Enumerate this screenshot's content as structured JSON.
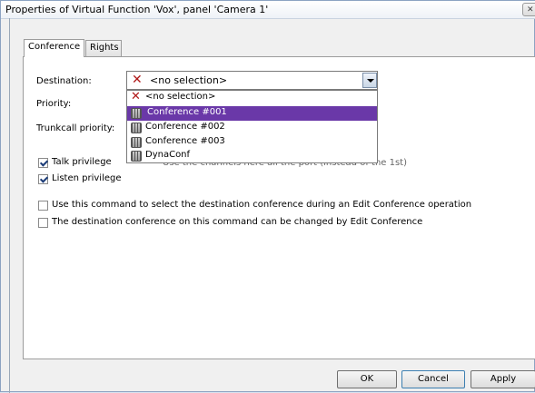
{
  "window": {
    "title": "Properties of Virtual Function 'Vox', panel 'Camera 1'"
  },
  "tabs": [
    {
      "label": "Conference",
      "active": true
    },
    {
      "label": "Rights",
      "active": false
    }
  ],
  "form": {
    "destination_label": "Destination:",
    "priority_label": "Priority:",
    "trunkcall_label": "Trunkcall priority:",
    "destination_value": "<no selection>",
    "hidden_text": "Use the channels here all the port (instead of the 1st)"
  },
  "dropdown": {
    "options": [
      {
        "label": "<no selection>",
        "icon": "x-icon"
      },
      {
        "label": "Conference #001",
        "icon": "conference-icon",
        "selected": true
      },
      {
        "label": "Conference #002",
        "icon": "conference-icon"
      },
      {
        "label": "Conference #003",
        "icon": "conference-icon"
      },
      {
        "label": "DynaConf",
        "icon": "conference-icon"
      }
    ]
  },
  "checkboxes": {
    "talk": {
      "label": "Talk privilege",
      "checked": true
    },
    "listen": {
      "label": "Listen privilege",
      "checked": true
    },
    "select_dest": {
      "label": "Use this command to select the destination conference during an Edit Conference operation",
      "checked": false
    },
    "changeable": {
      "label": "The destination conference on this command can be changed by Edit Conference",
      "checked": false
    }
  },
  "buttons": {
    "ok": "OK",
    "cancel": "Cancel",
    "apply": "Apply"
  },
  "colors": {
    "selection": "#6a38a8",
    "x_icon": "#b01818"
  }
}
